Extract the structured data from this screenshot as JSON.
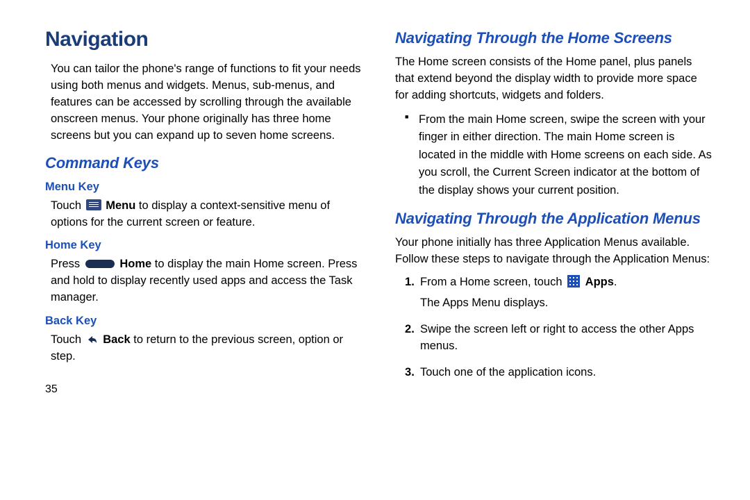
{
  "left": {
    "h1": "Navigation",
    "intro": "You can tailor the phone's range of functions to fit your needs using both menus and widgets. Menus, sub-menus, and features can be accessed by scrolling through the available onscreen menus. Your phone originally has three home screens but you can expand up to seven home screens.",
    "h2": "Command Keys",
    "menuKey": {
      "h3": "Menu Key",
      "pre": "Touch ",
      "bold": "Menu",
      "post": " to display a context-sensitive menu of options for the current screen or feature."
    },
    "homeKey": {
      "h3": "Home Key",
      "pre": "Press ",
      "bold": "Home",
      "post": " to display the main Home screen. Press and hold to display recently used apps and access the Task manager."
    },
    "backKey": {
      "h3": "Back Key",
      "pre": "Touch ",
      "bold": "Back",
      "post": " to return to the previous screen, option or step."
    },
    "page": "35"
  },
  "right": {
    "h2a": "Navigating Through the Home Screens",
    "pa": "The Home screen consists of the Home panel, plus panels that extend beyond the display width to provide more space for adding shortcuts, widgets and folders.",
    "bullet": "From the main Home screen, swipe the screen with your finger in either direction. The main Home screen is located in the middle with Home screens on each side. As you scroll, the Current Screen indicator at the bottom of the display shows your current position.",
    "h2b": "Navigating Through the Application Menus",
    "pb": "Your phone initially has three Application Menus available. Follow these steps to navigate through the Application Menus:",
    "steps": {
      "s1pre": "From a Home screen, touch ",
      "s1bold": "Apps",
      "s1post": ".",
      "s1sub": "The Apps Menu displays.",
      "s2": "Swipe the screen left or right to access the other Apps menus.",
      "s3": "Touch one of the application icons."
    }
  }
}
